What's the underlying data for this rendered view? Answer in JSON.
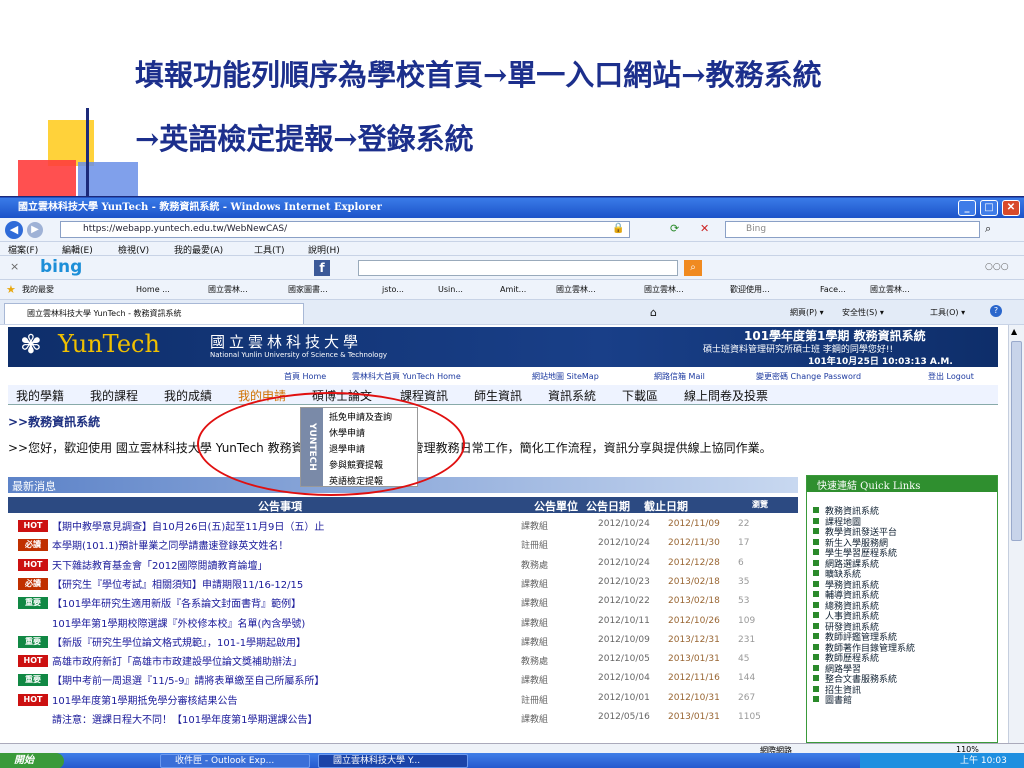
{
  "slide": {
    "title_line1": "填報功能列順序為學校首頁→單一入口網站→教務系統",
    "title_line2": "→英語檢定提報→登錄系統"
  },
  "window": {
    "title": "國立雲林科技大學 YunTech - 教務資訊系統 - Windows Internet Explorer",
    "min": "_",
    "max": "□",
    "close": "✕"
  },
  "address": {
    "url": "https://webapp.yuntech.edu.tw/WebNewCAS/",
    "search_placeholder": "Bing"
  },
  "menubar": [
    "檔案(F)",
    "編輯(E)",
    "檢視(V)",
    "我的最愛(A)",
    "工具(T)",
    "說明(H)"
  ],
  "bing": {
    "logo": "bing"
  },
  "favorites": {
    "label": "我的最愛",
    "items": [
      "Home ...",
      "國立雲林...",
      "國家圖書...",
      "jsto...",
      "Usin...",
      "Amit...",
      "國立雲林...",
      "國立雲林...",
      "歡迎使用...",
      "Face...",
      "國立雲林..."
    ]
  },
  "tab": {
    "label": "國立雲林科技大學 YunTech - 教務資訊系統",
    "tools": [
      "網頁(P) ▾",
      "安全性(S) ▾",
      "工具(O) ▾"
    ]
  },
  "banner": {
    "logo_latin": "YunTech",
    "school_zh": "國立雲林科技大學",
    "school_en": "National Yunlin University of Science & Technology",
    "term": "101學年度第1學期 教務資訊系統",
    "user": "碩士班資料管理研究所碩士班 李鋼的同學您好!!",
    "datetime": "101年10月25日 10:03:13 A.M."
  },
  "toplinks": [
    "首頁 Home",
    "雲林科大首頁 YunTech Home",
    "網站地圖 SiteMap",
    "網路信箱 Mail",
    "變更密碼 Change Password",
    "登出 Logout"
  ],
  "menu": [
    "我的學籍",
    "我的課程",
    "我的成績",
    "我的申請",
    "碩博士論文",
    "課程資訊",
    "師生資訊",
    "資訊系統",
    "下載區",
    "線上問卷及投票"
  ],
  "breadcrumb": ">>教務資訊系統",
  "dropdown": {
    "side_label": "YUNTECH",
    "items": [
      "抵免申請及查詢",
      "休學申請",
      "退學申請",
      "參與競賽提報",
      "英語檢定提報"
    ]
  },
  "welcome": ">>您好，歡迎使用 國立雲林科技大學 YunTech 教務資訊系統，此系統集中管理教務日常工作，簡化工作流程，資訊分享與提供線上協同作業。",
  "news": {
    "header": "最新消息",
    "columns": [
      "公告事項",
      "公告單位",
      "公告日期",
      "截止日期",
      "瀏覽"
    ],
    "rows": [
      {
        "badge": "HOT",
        "badge_color": "#cc1111",
        "title": "【期中教學意見調查】自10月26日(五)起至11月9日（五）止",
        "unit": "課教組",
        "pub": "2012/10/24",
        "end": "2012/11/09",
        "views": "22"
      },
      {
        "badge": "必讀",
        "badge_color": "#c03000",
        "title": "本學期(101.1)預計畢業之同學請盡速登錄英文姓名！",
        "unit": "註冊組",
        "pub": "2012/10/24",
        "end": "2012/11/30",
        "views": "17"
      },
      {
        "badge": "HOT",
        "badge_color": "#cc1111",
        "title": "天下雜誌教育基金會「2012國際閱讀教育論壇」",
        "unit": "教務處",
        "pub": "2012/10/24",
        "end": "2012/12/28",
        "views": "6"
      },
      {
        "badge": "必讀",
        "badge_color": "#c03000",
        "title": "【研究生『學位考試』相關須知】申請期限11/16-12/15",
        "unit": "課教組",
        "pub": "2012/10/23",
        "end": "2013/02/18",
        "views": "35"
      },
      {
        "badge": "重要",
        "badge_color": "#118844",
        "title": "【101學年研究生適用新版『各系論文封面書背』範例】",
        "unit": "課教組",
        "pub": "2012/10/22",
        "end": "2013/02/18",
        "views": "53"
      },
      {
        "badge": "",
        "badge_color": "#ffffff",
        "title": "101學年第1學期校際選課『外校修本校』名單(內含學號)",
        "unit": "課教組",
        "pub": "2012/10/11",
        "end": "2012/10/26",
        "views": "109"
      },
      {
        "badge": "重要",
        "badge_color": "#118844",
        "title": "【新版『研究生學位論文格式規範』，101-1學期起啟用】",
        "unit": "課教組",
        "pub": "2012/10/09",
        "end": "2013/12/31",
        "views": "231"
      },
      {
        "badge": "HOT",
        "badge_color": "#cc1111",
        "title": "高雄市政府新訂「高雄市市政建設學位論文獎補助辦法」",
        "unit": "教務處",
        "pub": "2012/10/05",
        "end": "2013/01/31",
        "views": "45"
      },
      {
        "badge": "重要",
        "badge_color": "#118844",
        "title": "【期中考前一周退選『11/5-9』請將表單繳至自己所屬系所】",
        "unit": "課教組",
        "pub": "2012/10/04",
        "end": "2012/11/16",
        "views": "144"
      },
      {
        "badge": "HOT",
        "badge_color": "#cc1111",
        "title": "101學年度第1學期抵免學分審核結果公告",
        "unit": "註冊組",
        "pub": "2012/10/01",
        "end": "2012/10/31",
        "views": "267"
      },
      {
        "badge": "",
        "badge_color": "#ffffff",
        "title": "請注意：選課日程大不同！【101學年度第1學期選課公告】",
        "unit": "課教組",
        "pub": "2012/05/16",
        "end": "2013/01/31",
        "views": "1105"
      }
    ]
  },
  "quicklinks": {
    "header": "快速連結 Quick Links",
    "items": [
      "教務資訊系統",
      "課程地圖",
      "教學資訊發送平台",
      "新生入學服務網",
      "學生學習歷程系統",
      "網路選課系統",
      "曠缺系統",
      "學務資訊系統",
      "輔導資訊系統",
      "總務資訊系統",
      "人事資訊系統",
      "研發資訊系統",
      "教師評鑑管理系統",
      "教師著作目錄管理系統",
      "教師歷程系統",
      "網路學習",
      "整合文書服務系統",
      "招生資訊",
      "圖書館"
    ]
  },
  "statusbar": {
    "zone": "網際網路",
    "zoom": "110%"
  },
  "taskbar": {
    "start": "開始",
    "tasks": [
      "收件匣 - Outlook Exp...",
      "國立雲林科技大學 Y..."
    ],
    "clock": "上午 10:03"
  }
}
